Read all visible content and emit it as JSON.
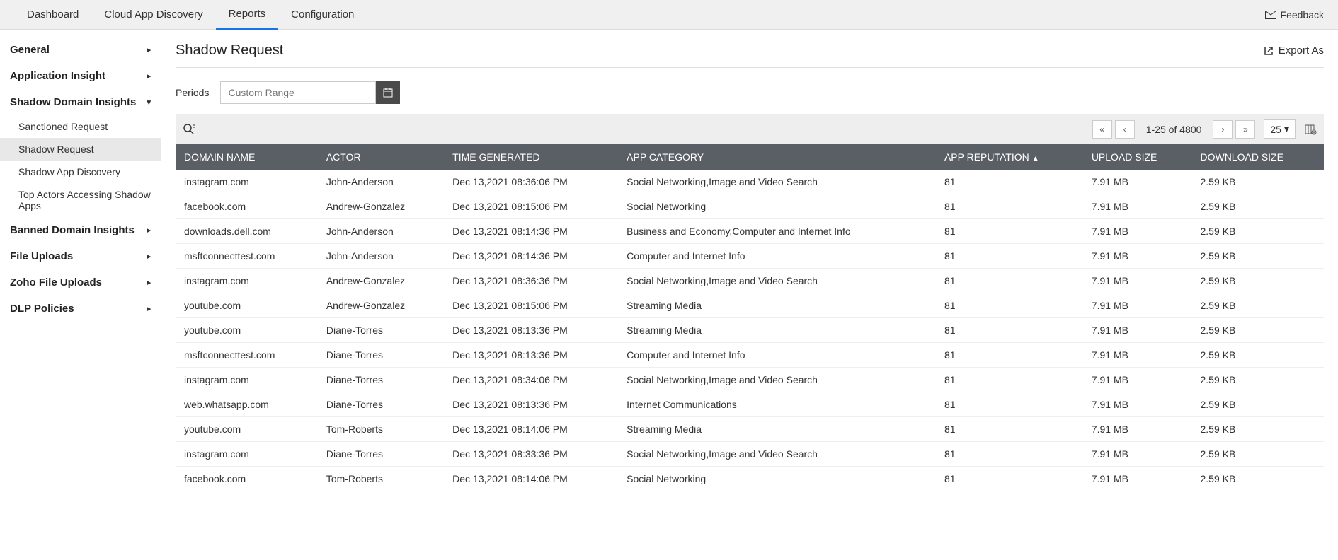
{
  "topnav": {
    "tabs": [
      "Dashboard",
      "Cloud App Discovery",
      "Reports",
      "Configuration"
    ],
    "active": 2,
    "feedback": "Feedback"
  },
  "sidebar": {
    "items": [
      {
        "label": "General",
        "expanded": false,
        "children": []
      },
      {
        "label": "Application Insight",
        "expanded": false,
        "children": []
      },
      {
        "label": "Shadow Domain Insights",
        "expanded": true,
        "children": [
          "Sanctioned Request",
          "Shadow Request",
          "Shadow App Discovery",
          "Top Actors Accessing Shadow Apps"
        ],
        "activeChild": 1
      },
      {
        "label": "Banned Domain Insights",
        "expanded": false,
        "children": []
      },
      {
        "label": "File Uploads",
        "expanded": false,
        "children": []
      },
      {
        "label": "Zoho File Uploads",
        "expanded": false,
        "children": []
      },
      {
        "label": "DLP Policies",
        "expanded": false,
        "children": []
      }
    ]
  },
  "page": {
    "title": "Shadow Request",
    "export": "Export As",
    "periods_label": "Periods",
    "date_placeholder": "Custom Range"
  },
  "pagination": {
    "text": "1-25 of 4800",
    "page_size": "25"
  },
  "table": {
    "columns": [
      "DOMAIN NAME",
      "ACTOR",
      "TIME GENERATED",
      "APP CATEGORY",
      "APP REPUTATION",
      "UPLOAD SIZE",
      "DOWNLOAD SIZE"
    ],
    "sort_column": 4,
    "rows": [
      {
        "domain": "instagram.com",
        "actor": "John-Anderson",
        "time": "Dec 13,2021 08:36:06 PM",
        "category": "Social Networking,Image and Video Search",
        "reputation": "81",
        "upload": "7.91 MB",
        "download": "2.59 KB"
      },
      {
        "domain": "facebook.com",
        "actor": "Andrew-Gonzalez",
        "time": "Dec 13,2021 08:15:06 PM",
        "category": "Social Networking",
        "reputation": "81",
        "upload": "7.91 MB",
        "download": "2.59 KB"
      },
      {
        "domain": "downloads.dell.com",
        "actor": "John-Anderson",
        "time": "Dec 13,2021 08:14:36 PM",
        "category": "Business and Economy,Computer and Internet Info",
        "reputation": "81",
        "upload": "7.91 MB",
        "download": "2.59 KB"
      },
      {
        "domain": "msftconnecttest.com",
        "actor": "John-Anderson",
        "time": "Dec 13,2021 08:14:36 PM",
        "category": "Computer and Internet Info",
        "reputation": "81",
        "upload": "7.91 MB",
        "download": "2.59 KB"
      },
      {
        "domain": "instagram.com",
        "actor": "Andrew-Gonzalez",
        "time": "Dec 13,2021 08:36:36 PM",
        "category": "Social Networking,Image and Video Search",
        "reputation": "81",
        "upload": "7.91 MB",
        "download": "2.59 KB"
      },
      {
        "domain": "youtube.com",
        "actor": "Andrew-Gonzalez",
        "time": "Dec 13,2021 08:15:06 PM",
        "category": "Streaming Media",
        "reputation": "81",
        "upload": "7.91 MB",
        "download": "2.59 KB"
      },
      {
        "domain": "youtube.com",
        "actor": "Diane-Torres",
        "time": "Dec 13,2021 08:13:36 PM",
        "category": "Streaming Media",
        "reputation": "81",
        "upload": "7.91 MB",
        "download": "2.59 KB"
      },
      {
        "domain": "msftconnecttest.com",
        "actor": "Diane-Torres",
        "time": "Dec 13,2021 08:13:36 PM",
        "category": "Computer and Internet Info",
        "reputation": "81",
        "upload": "7.91 MB",
        "download": "2.59 KB"
      },
      {
        "domain": "instagram.com",
        "actor": "Diane-Torres",
        "time": "Dec 13,2021 08:34:06 PM",
        "category": "Social Networking,Image and Video Search",
        "reputation": "81",
        "upload": "7.91 MB",
        "download": "2.59 KB"
      },
      {
        "domain": "web.whatsapp.com",
        "actor": "Diane-Torres",
        "time": "Dec 13,2021 08:13:36 PM",
        "category": "Internet Communications",
        "reputation": "81",
        "upload": "7.91 MB",
        "download": "2.59 KB"
      },
      {
        "domain": "youtube.com",
        "actor": "Tom-Roberts",
        "time": "Dec 13,2021 08:14:06 PM",
        "category": "Streaming Media",
        "reputation": "81",
        "upload": "7.91 MB",
        "download": "2.59 KB"
      },
      {
        "domain": "instagram.com",
        "actor": "Diane-Torres",
        "time": "Dec 13,2021 08:33:36 PM",
        "category": "Social Networking,Image and Video Search",
        "reputation": "81",
        "upload": "7.91 MB",
        "download": "2.59 KB"
      },
      {
        "domain": "facebook.com",
        "actor": "Tom-Roberts",
        "time": "Dec 13,2021 08:14:06 PM",
        "category": "Social Networking",
        "reputation": "81",
        "upload": "7.91 MB",
        "download": "2.59 KB"
      }
    ]
  }
}
